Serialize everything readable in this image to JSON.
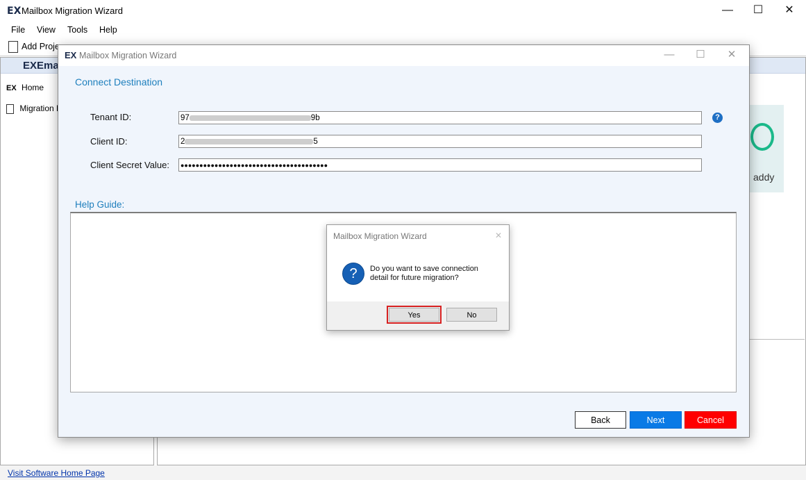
{
  "app": {
    "logo": "EX",
    "title": "Mailbox Migration Wizard",
    "window_controls": {
      "minimize": "—",
      "maximize": "☐",
      "close": "✕"
    }
  },
  "menu": [
    "File",
    "View",
    "Tools",
    "Help"
  ],
  "toolbar": {
    "add_project_label": "Add Proje"
  },
  "left_panel": {
    "brand": "Ema",
    "items": [
      {
        "label": "Home",
        "icon": "ex-logo-icon"
      },
      {
        "label": "Migration Pr",
        "icon": "document-icon"
      }
    ]
  },
  "right_panel": {
    "card_label": "addy"
  },
  "footer": {
    "link": "Visit Software Home Page"
  },
  "dialog": {
    "title": "Mailbox Migration Wizard",
    "section_title": "Connect Destination",
    "fields": {
      "tenant_label": "Tenant ID:",
      "tenant_value_start": "97",
      "tenant_value_end": "9b",
      "client_label": "Client ID:",
      "client_value_start": "2",
      "client_value_end": "5",
      "secret_label": "Client Secret Value:",
      "secret_value": "●●●●●●●●●●●●●●●●●●●●●●●●●●●●●●●●●●●●●●●"
    },
    "help_icon": "?",
    "help_guide_label": "Help Guide:",
    "buttons": {
      "back": "Back",
      "next": "Next",
      "cancel": "Cancel"
    }
  },
  "message_box": {
    "title": "Mailbox Migration Wizard",
    "close": "✕",
    "icon": "?",
    "text": "Do you want to save connection\n detail for future migration?",
    "buttons": {
      "yes": "Yes",
      "no": "No"
    }
  },
  "colors": {
    "accent_blue": "#1e7fbd",
    "next_button": "#0a7ae6",
    "cancel_button": "#ff0000",
    "highlight_outline": "#d62020"
  }
}
